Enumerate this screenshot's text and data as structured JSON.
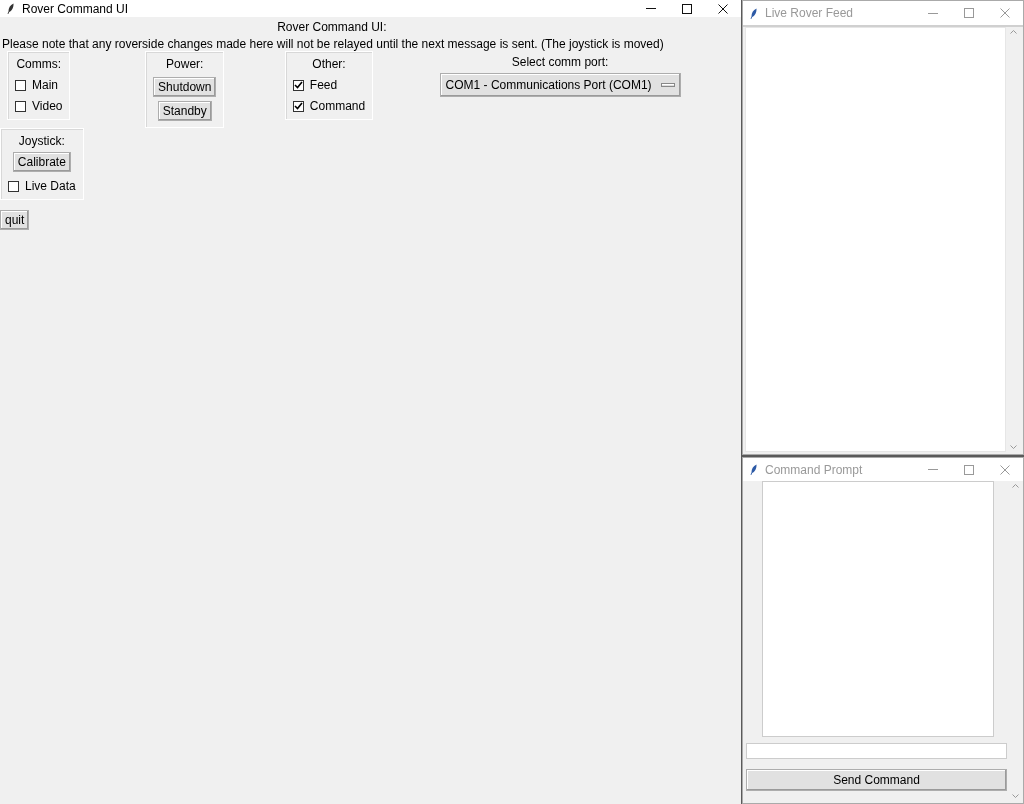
{
  "main_window": {
    "title": "Rover Command UI",
    "active": true,
    "heading": "Rover Command UI:",
    "note": "Please note that any roverside changes made here will not be relayed until the next message is sent. (The joystick is moved)",
    "groups": [
      {
        "kind": "checks",
        "title": "Comms:",
        "checkboxes": [
          {
            "label": "Main",
            "checked": false
          },
          {
            "label": "Video",
            "checked": false
          }
        ]
      },
      {
        "kind": "buttons",
        "title": "Power:",
        "buttons": [
          "Shutdown",
          "Standby"
        ]
      },
      {
        "kind": "checks",
        "title": "Other:",
        "checkboxes": [
          {
            "label": "Feed",
            "checked": true
          },
          {
            "label": "Command",
            "checked": true
          }
        ]
      }
    ],
    "port": {
      "label": "Select comm port:",
      "value": "COM1 - Communications Port (COM1)"
    },
    "joystick": {
      "title": "Joystick:",
      "button": "Calibrate",
      "checkbox": {
        "label": "Live Data",
        "checked": false
      }
    },
    "quit_button": "quit"
  },
  "feed_window": {
    "title": "Live Rover Feed",
    "active": false
  },
  "prompt_window": {
    "title": "Command Prompt",
    "active": false,
    "send_button": "Send Command"
  }
}
